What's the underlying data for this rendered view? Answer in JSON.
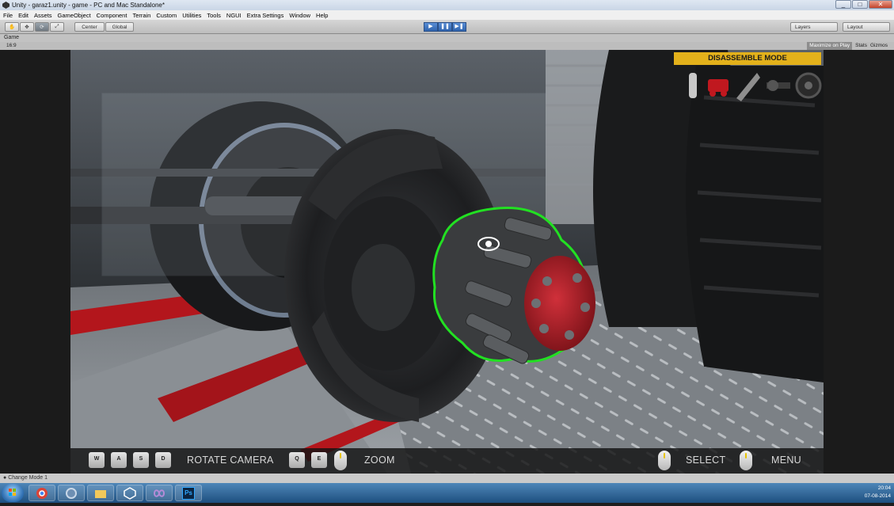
{
  "window": {
    "title": "Unity - garaz1.unity - game - PC and Mac Standalone*",
    "buttons": [
      "_",
      "□",
      "✕"
    ]
  },
  "menubar": {
    "items": [
      "File",
      "Edit",
      "Assets",
      "GameObject",
      "Component",
      "Terrain",
      "Custom",
      "Utilities",
      "Tools",
      "NGUI",
      "Extra Settings",
      "Window",
      "Help"
    ]
  },
  "toolbar": {
    "pivot_center": "Center",
    "pivot_global": "Global",
    "layers": "Layers",
    "layout": "Layout"
  },
  "game_view": {
    "tab_label": "Game",
    "aspect": "16:9",
    "maximize_on_play": "Maximize on Play",
    "stats": "Stats",
    "gizmos": "Gizmos"
  },
  "hud": {
    "mode_banner": "DISASSEMBLE MODE",
    "keys_move": [
      "W",
      "A",
      "S",
      "D"
    ],
    "rotate_label": "ROTATE CAMERA",
    "keys_zoom": [
      "Q",
      "E"
    ],
    "zoom_label": "ZOOM",
    "select_label": "SELECT",
    "menu_label": "MENU"
  },
  "statusbar": {
    "message": "Change Mode 1"
  },
  "taskbar": {
    "apps": [
      "chrome",
      "settings",
      "explorer",
      "unity",
      "visual-studio",
      "photoshop"
    ],
    "ps_label": "Ps",
    "time": "20:04",
    "date": "07-08-2014"
  },
  "colors": {
    "accent_banner": "#e3b11b",
    "highlight_outline": "#22e022",
    "hub_red": "#b0202a"
  }
}
